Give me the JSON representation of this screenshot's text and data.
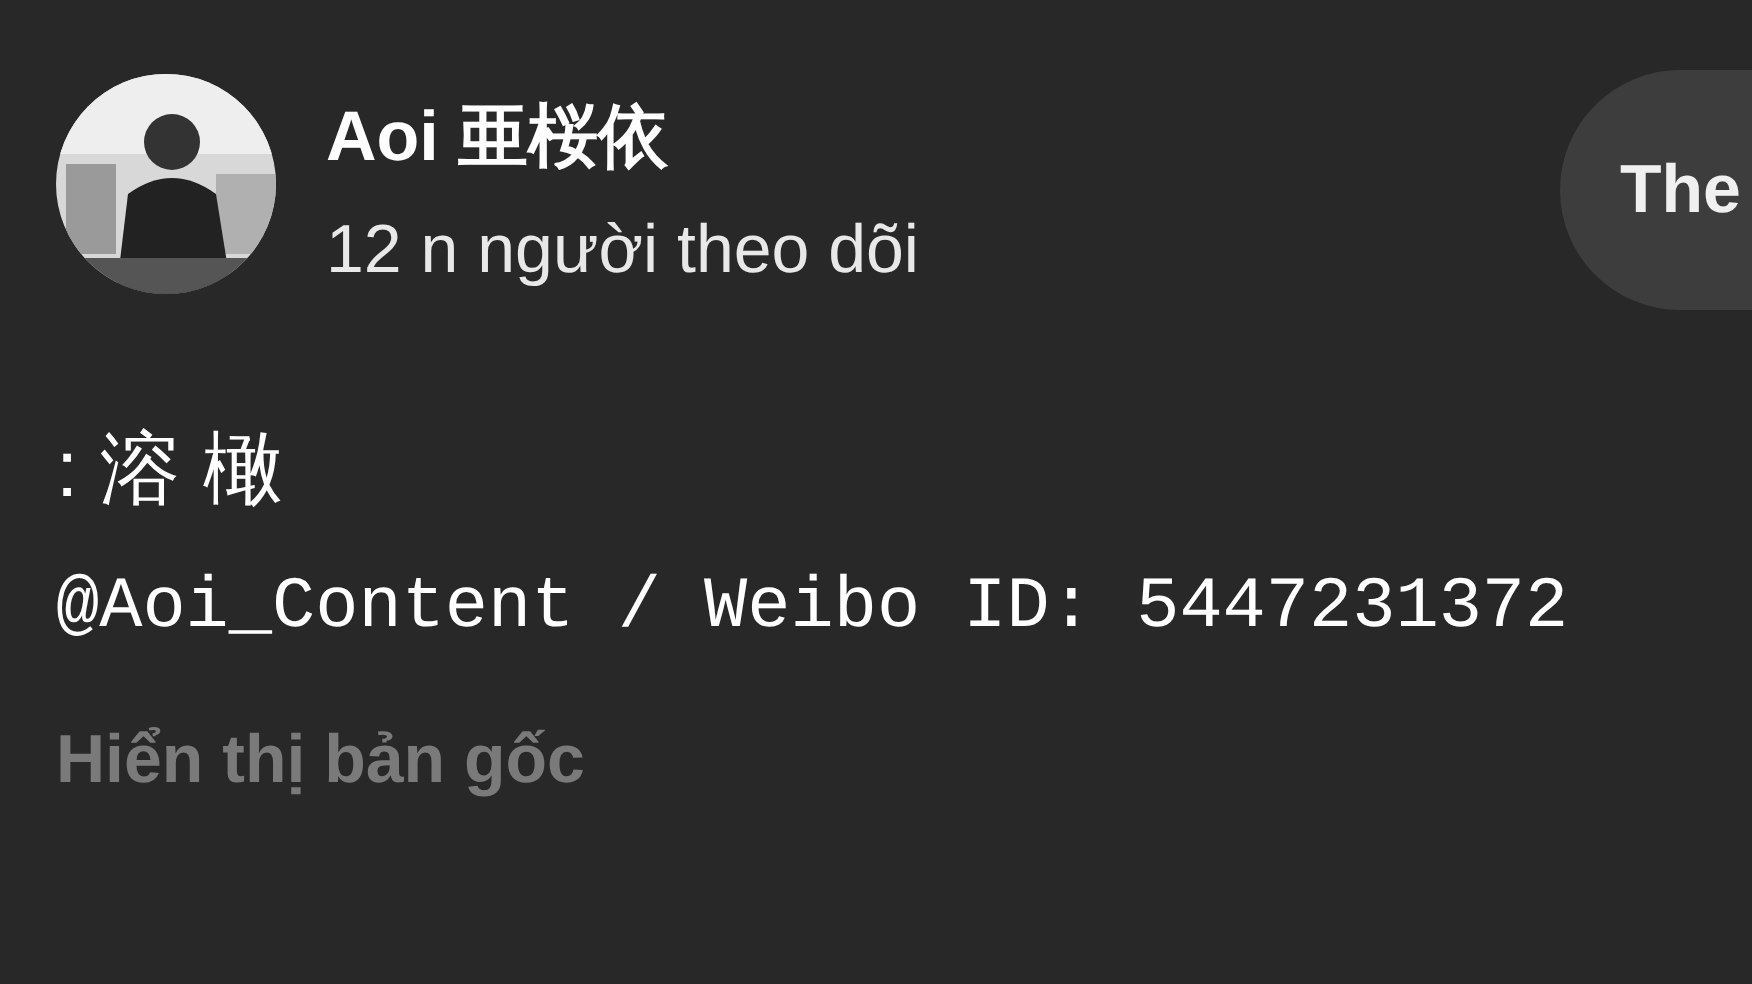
{
  "channel": {
    "name": "Aoi 亜桜依",
    "subscribers": "12 n người theo dõi",
    "button": "The"
  },
  "post": {
    "lines": [
      ": 溶 橄",
      "@Aoi_Content / Weibo ID: 5447231372"
    ],
    "show_original": "Hiển thị bản gốc"
  }
}
